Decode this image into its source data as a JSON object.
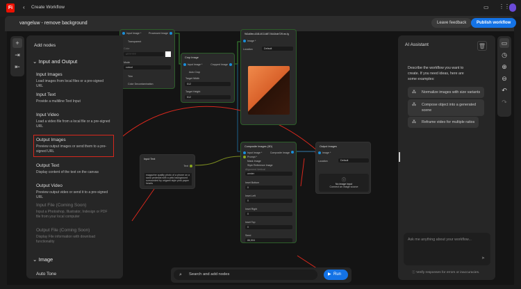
{
  "app": {
    "title": "Create Workflow",
    "logo": "Fi"
  },
  "header": {
    "workflow_name": "vangeluw - remove background",
    "leave_feedback": "Leave feedback",
    "publish": "Publish workflow"
  },
  "add_panel": {
    "title": "Add nodes",
    "sections": [
      {
        "label": "Input and Output",
        "items": [
          {
            "title": "Input Images",
            "desc": "Load images from local files or a pre-signed URL"
          },
          {
            "title": "Input Text",
            "desc": "Provide a multiline Text Input"
          },
          {
            "title": "Input Video",
            "desc": "Load a video file from a local file or a pre-signed URL"
          },
          {
            "title": "Output Images",
            "desc": "Preview output images or send them to a pre-signed URL"
          },
          {
            "title": "Output Text",
            "desc": "Display content of the text on the canvas"
          },
          {
            "title": "Output Video",
            "desc": "Preview output video or send it to a pre-signed URL"
          },
          {
            "title": "Input File (Coming Soon)",
            "desc": "Input a Photoshop, Illustrator, Indesign or PDF file from your local computer"
          },
          {
            "title": "Output File (Coming Soon)",
            "desc": "Display File information with download functionality"
          }
        ]
      },
      {
        "label": "Image",
        "items": [
          {
            "title": "Auto Tone"
          }
        ]
      }
    ]
  },
  "ai": {
    "title": "AI Assistant",
    "desc": "Describe the workflow you want to create. If you need ideas, here are some examples:",
    "examples": [
      "Normalize images with size variants",
      "Compose object into a generated scene",
      "Reframe video for multiple ratios"
    ],
    "placeholder": "Ask me anything about your workflow...",
    "verify": "Verify responses for errors or inaccuracies."
  },
  "nodes": {
    "remove_bg": {
      "input": "Input Image *",
      "output": "Processed Image",
      "transparent": "Transparent",
      "color_label": "Color",
      "color_value": "#FFFFFF",
      "mode_label": "Mode",
      "mode": "cutout",
      "trim": "Trim",
      "decontam": "Color Decontamination"
    },
    "crop": {
      "title": "Crop Image",
      "input": "Input Image *",
      "output": "Cropped Image",
      "auto_crop": "Auto Crop",
      "w_label": "Target Width",
      "w": "512",
      "h_label": "Target Height",
      "h": "512"
    },
    "preview": {
      "title": "9b2a6fee-d348-4f13-b8f7-94d1bde72ff-rec.fg",
      "image": "Image *",
      "location_label": "Location",
      "location": "Default"
    },
    "composite": {
      "title": "Composite Images (3D)",
      "input": "Input Image *",
      "prompt": "Prompt *",
      "mask": "Mask Image",
      "style": "Style Reference Image",
      "placement_label": "Alignment Vertical",
      "placement": "center",
      "fields": [
        {
          "label": "Inset Bottom",
          "value": "0"
        },
        {
          "label": "Inset Left",
          "value": "0"
        },
        {
          "label": "Inset Right",
          "value": "0"
        },
        {
          "label": "Inset Top",
          "value": "0"
        },
        {
          "label": "Seed",
          "value": "86,504"
        }
      ],
      "output": "Composite Image"
    },
    "output_images": {
      "title": "Output Images",
      "image": "Image *",
      "location_label": "Location",
      "location": "Default",
      "empty": "No image input",
      "empty_sub": "Connect an image source"
    },
    "input_text": {
      "title": "Input Text",
      "output": "Text",
      "value": "magazine quality photo of a phone on a sand pedestal with a pink background surrounded by origami style pink paper hearts"
    }
  },
  "bottom": {
    "search": "Search and add nodes",
    "run": "Run"
  }
}
